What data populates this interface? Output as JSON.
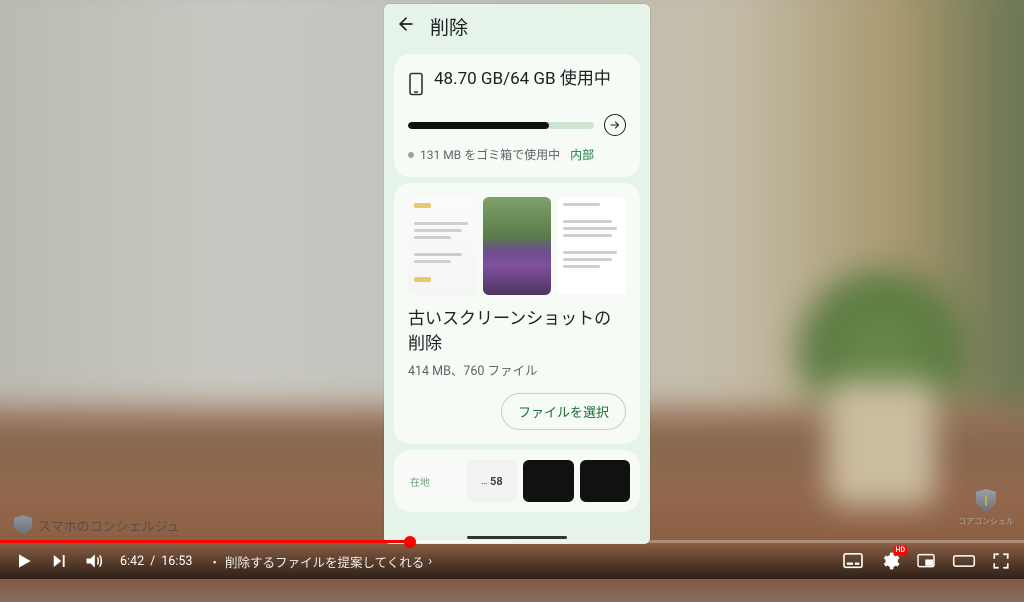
{
  "phone": {
    "header_title": "削除",
    "storage_text": "48.70 GB/64 GB 使用中",
    "progress_percent": 76,
    "trash_text": "131 MB をゴミ箱で使用中",
    "trash_link": "内部",
    "suggestion": {
      "title": "古いスクリーンショットの削除",
      "subtitle": "414 MB、760 ファイル",
      "button": "ファイルを選択"
    },
    "bottom_tiles": {
      "label": "在地",
      "ellipsis": "…",
      "count": "58"
    }
  },
  "youtube": {
    "current_time": "6:42",
    "duration": "16:53",
    "chapter_prefix": "・",
    "chapter": "削除するファイルを提案してくれる",
    "hd": "HD"
  },
  "channel_name": "スマホのコンシェルジュ",
  "watermark_label": "コアコンシェル"
}
